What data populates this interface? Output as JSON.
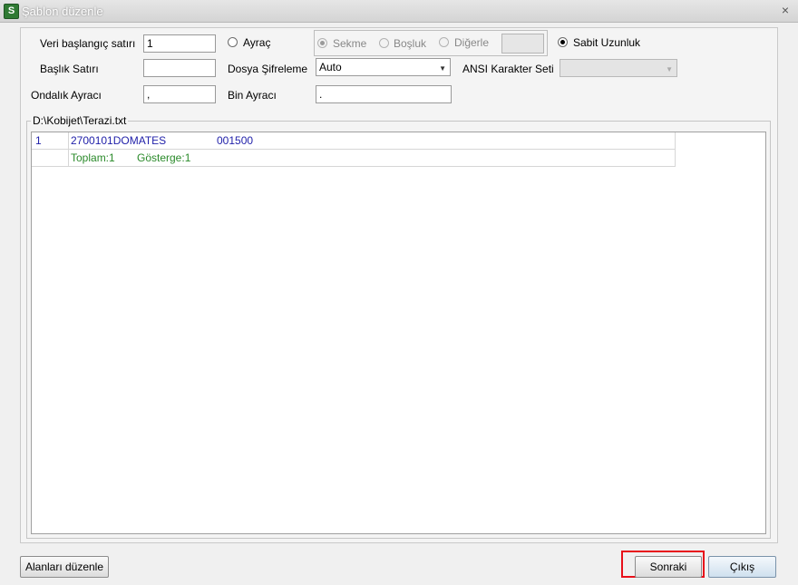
{
  "window": {
    "title": "Şablon düzenle",
    "icon": "app-logo-icon",
    "close_label": "×"
  },
  "form": {
    "data_start_row": {
      "label": "Veri başlangıç satırı",
      "value": "1"
    },
    "header_row": {
      "label": "Başlık Satırı",
      "value": ""
    },
    "decimal_separator": {
      "label": "Ondalık Ayracı",
      "value": ","
    },
    "delimiter": {
      "label": "Ayraç",
      "selected": false
    },
    "delimiter_options": [
      {
        "label": "Sekme",
        "selected": true,
        "enabled": false
      },
      {
        "label": "Boşluk",
        "selected": false,
        "enabled": false
      },
      {
        "label": "Diğerle",
        "selected": false,
        "enabled": false
      }
    ],
    "other_delimiter_value": "",
    "fixed_length": {
      "label": "Sabit Uzunluk",
      "selected": true
    },
    "file_encoding": {
      "label": "Dosya Şifreleme",
      "value": "Auto"
    },
    "ansi_charset": {
      "label": "ANSI Karakter Seti",
      "value": "",
      "enabled": false
    },
    "thousand_separator": {
      "label": "Bin Ayracı",
      "value": "."
    }
  },
  "preview": {
    "file_path": "D:\\Kobijet\\Terazi.txt",
    "rows": [
      {
        "num": "1",
        "col1": "2700101DOMATES",
        "col2": "001500"
      }
    ],
    "summary": {
      "total": "Toplam:1",
      "shown": "Gösterge:1"
    }
  },
  "buttons": {
    "edit_fields": "Alanları düzenle",
    "next": "Sonraki",
    "exit": "Çıkış"
  },
  "colors": {
    "highlight": "#e8101a",
    "row_text": "#2222aa",
    "summary_text": "#2a8a2a"
  }
}
